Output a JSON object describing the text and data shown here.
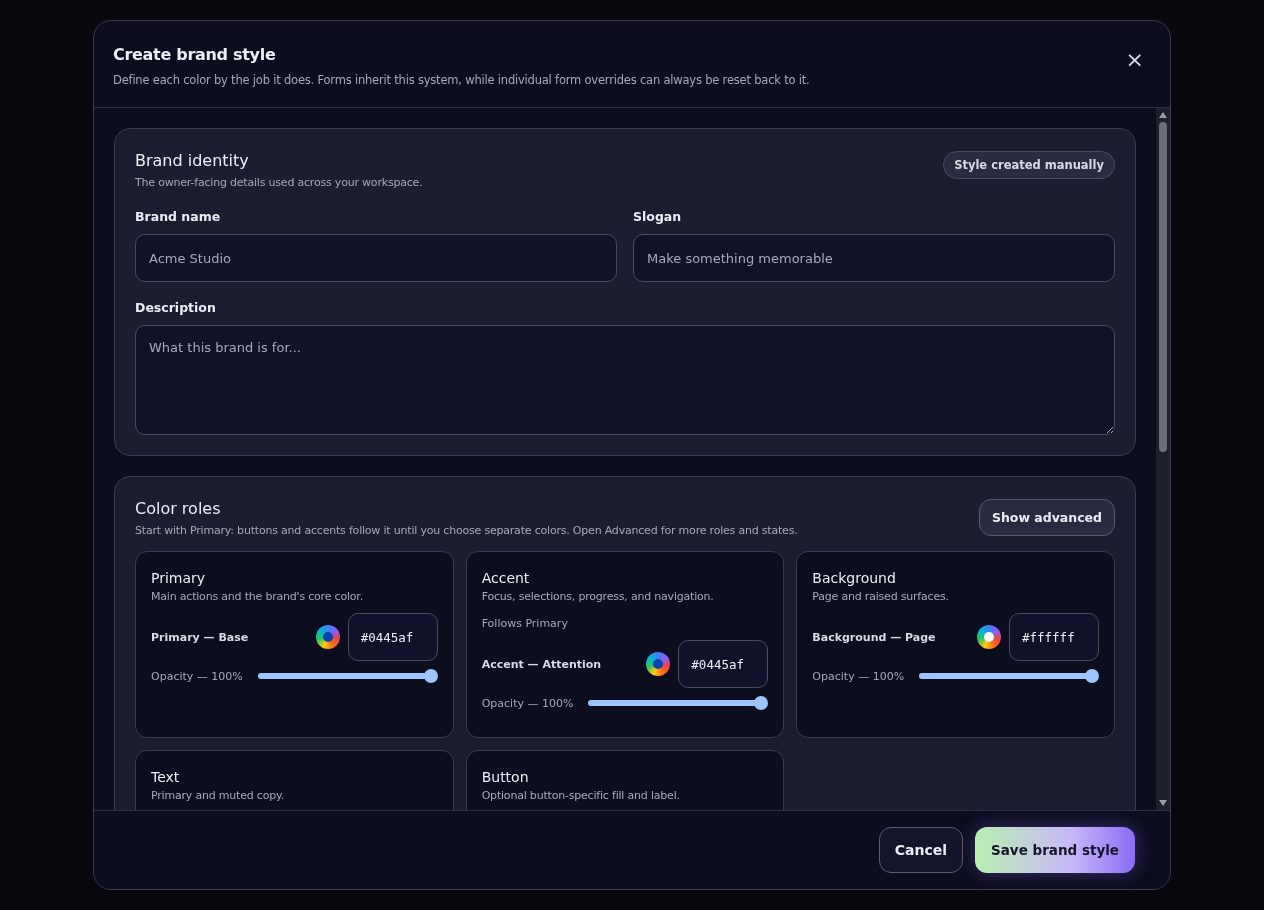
{
  "dialog": {
    "title": "Create brand style",
    "subtitle": "Define each color by the job it does. Forms inherit this system, while individual form overrides can always be reset back to it.",
    "close": "×"
  },
  "identity": {
    "title": "Brand identity",
    "subtitle": "The owner-facing details used across your workspace.",
    "badge": "Style created manually",
    "fields": [
      {
        "label": "Brand name",
        "placeholder": "Acme Studio"
      },
      {
        "label": "Slogan",
        "placeholder": "Make something memorable"
      }
    ],
    "description": {
      "label": "Description",
      "placeholder": "What this brand is for..."
    }
  },
  "color_roles": {
    "title": "Color roles",
    "subtitle": "Start with Primary: buttons and accents follow it until you choose separate colors. Open Advanced for more roles and states.",
    "advanced_button": "Show advanced",
    "roles": [
      {
        "name": "Primary",
        "description": "Main actions and the brand's core color.",
        "control": "Primary — Base",
        "hex": "#0445af",
        "opacity": "Opacity — 100%",
        "level": 1
      },
      {
        "name": "Accent",
        "description": "Focus, selections, progress, and navigation.",
        "note": "Follows Primary",
        "control": "Accent — Attention",
        "hex": "#0445af",
        "opacity": "Opacity — 100%",
        "level": 1
      },
      {
        "name": "Background",
        "description": "Page and raised surfaces.",
        "control": "Background — Page",
        "hex": "#ffffff",
        "opacity": "Opacity — 100%",
        "level": 1
      },
      {
        "name": "Text",
        "description": "Primary and muted copy."
      },
      {
        "name": "Button",
        "description": "Optional button-specific fill and label."
      }
    ]
  },
  "footer": {
    "cancel": "Cancel",
    "save": "Save brand style"
  }
}
